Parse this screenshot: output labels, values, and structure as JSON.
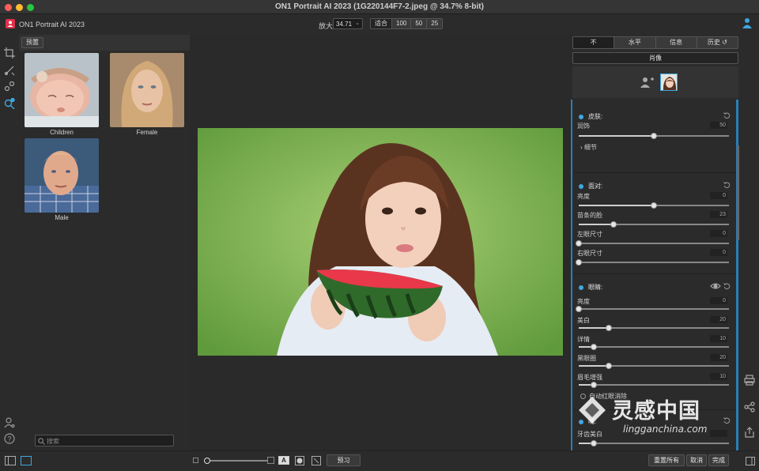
{
  "window": {
    "title": "ON1 Portrait AI 2023 (1G220144F7-2.jpeg @ 34.7% 8-bit)"
  },
  "app": {
    "name": "ON1 Portrait AI 2023"
  },
  "zoom": {
    "label": "放大",
    "value": "34.71",
    "buttons": [
      "适合",
      "100",
      "50",
      "25"
    ]
  },
  "presets": {
    "tab": "预置",
    "items": [
      {
        "label": "Children"
      },
      {
        "label": "Female"
      },
      {
        "label": "Male"
      }
    ],
    "search_placeholder": "搜索"
  },
  "right_panel": {
    "tabs": [
      "不",
      "水平",
      "信息",
      "历史"
    ],
    "portrait_label": "肖像",
    "sections": [
      {
        "title": "皮肤:",
        "sliders": [
          {
            "label": "润饰",
            "value": "50",
            "level": 0.5
          }
        ],
        "detail": "细节"
      },
      {
        "title": "面对:",
        "sliders": [
          {
            "label": "亮度",
            "value": "0",
            "level": 0.5
          },
          {
            "label": "苗条的脸",
            "value": "23",
            "level": 0.23
          },
          {
            "label": "左眼尺寸",
            "value": "0",
            "level": 0.0
          },
          {
            "label": "右眼尺寸",
            "value": "0",
            "level": 0.0
          }
        ]
      },
      {
        "title": "眼睛:",
        "sliders": [
          {
            "label": "亮度",
            "value": "0",
            "level": 0.0
          },
          {
            "label": "美白",
            "value": "20",
            "level": 0.2
          },
          {
            "label": "详情",
            "value": "10",
            "level": 0.1
          },
          {
            "label": "黑眼圈",
            "value": "20",
            "level": 0.2
          },
          {
            "label": "眉毛增强",
            "value": "10",
            "level": 0.1
          }
        ],
        "extra": "自动红眼消除"
      },
      {
        "title": "嘴:",
        "sliders": [
          {
            "label": "牙齿美白",
            "value": "",
            "level": 0.1
          }
        ]
      }
    ]
  },
  "bottom": {
    "preview_label": "预习",
    "reset_label": "重置所有",
    "cancel_label": "取消",
    "done_label": "完成",
    "a_label": "A"
  },
  "watermark": {
    "title": "灵感中国",
    "url": "lingganchina.com"
  },
  "colors": {
    "accent": "#3fa7e0",
    "traffic_red": "#ff5f57",
    "traffic_yellow": "#febc2e",
    "traffic_green": "#28c840",
    "logo": "#e0304a"
  }
}
